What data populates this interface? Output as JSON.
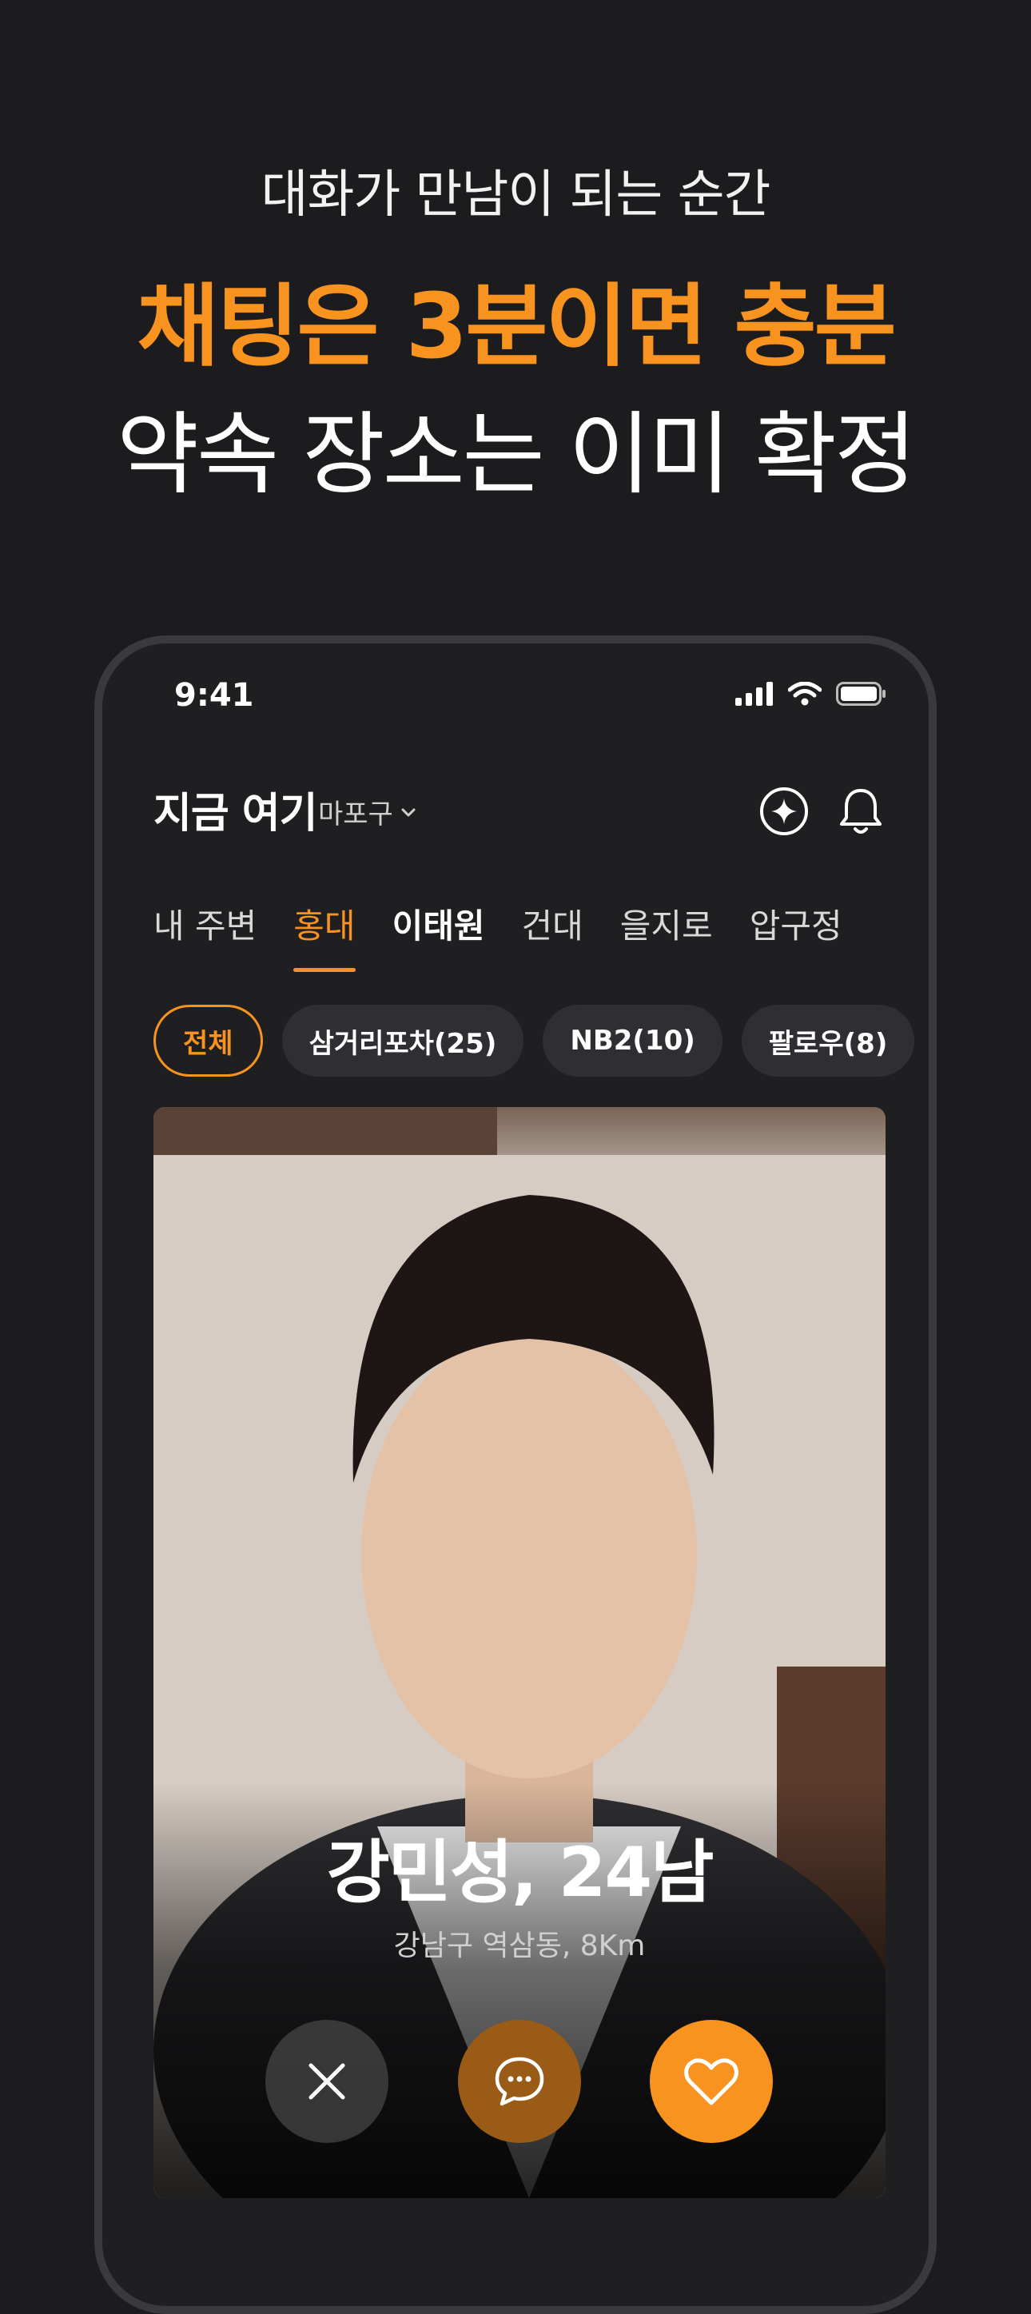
{
  "headline": {
    "sub": "대화가 만남이 되는 순간",
    "main": "채팅은 3분이면 충분",
    "third": "약속 장소는 이미 확정"
  },
  "status_bar": {
    "time": "9:41"
  },
  "header": {
    "title": "지금 여기",
    "location": "마포구"
  },
  "tabs": [
    {
      "label": "내 주변"
    },
    {
      "label": "홍대"
    },
    {
      "label": "이태원"
    },
    {
      "label": "건대"
    },
    {
      "label": "을지로"
    },
    {
      "label": "압구정"
    }
  ],
  "chips": [
    {
      "label": "전체"
    },
    {
      "label": "삼거리포차(25)"
    },
    {
      "label": "NB2(10)"
    },
    {
      "label": "팔로우(8)"
    }
  ],
  "profile": {
    "name": "강민성, 24남",
    "location": "강남구 역삼동, 8Km"
  },
  "colors": {
    "accent": "#f7931e",
    "background": "#1c1c1f"
  }
}
